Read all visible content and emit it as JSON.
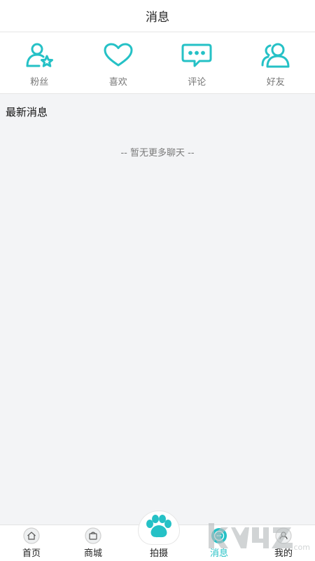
{
  "header": {
    "title": "消息"
  },
  "quick_actions": [
    {
      "label": "粉丝",
      "icon": "fans-icon"
    },
    {
      "label": "喜欢",
      "icon": "heart-icon"
    },
    {
      "label": "评论",
      "icon": "comment-icon"
    },
    {
      "label": "好友",
      "icon": "friends-icon"
    }
  ],
  "section": {
    "title": "最新消息",
    "empty_text": "-- 暂无更多聊天 --"
  },
  "bottom_nav": {
    "items": [
      {
        "label": "首页",
        "icon": "home-icon"
      },
      {
        "label": "商城",
        "icon": "shop-icon"
      },
      {
        "label": "拍摄",
        "icon": "paw-icon"
      },
      {
        "label": "消息",
        "icon": "message-icon"
      },
      {
        "label": "我的",
        "icon": "profile-icon"
      }
    ],
    "active_index": 3
  },
  "colors": {
    "accent": "#25c1c6",
    "background": "#f3f4f6"
  },
  "watermark": {
    "text": "k 4 z",
    "subtext": ".com"
  }
}
